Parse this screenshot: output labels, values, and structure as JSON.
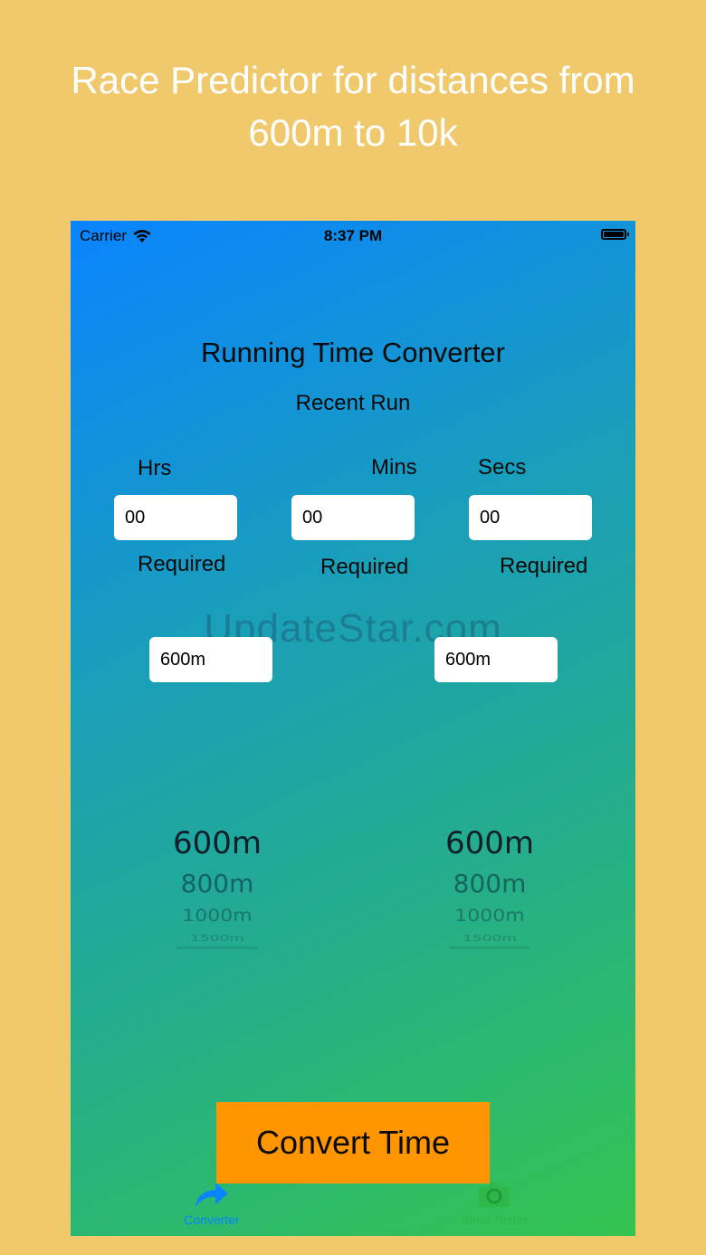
{
  "promo": {
    "line1": "Race Predictor for distances from",
    "line2": "600m to 10k"
  },
  "status_bar": {
    "carrier": "Carrier",
    "time": "8:37 PM"
  },
  "app": {
    "title": "Running Time Converter",
    "subtitle": "Recent Run",
    "labels": {
      "hrs": "Hrs",
      "mins": "Mins",
      "secs": "Secs"
    },
    "inputs": {
      "hrs": "00",
      "mins": "00",
      "secs": "00"
    },
    "required": {
      "hrs": "Required",
      "mins": "Required",
      "secs": "Required"
    },
    "from_distance": "600m",
    "to_distance": "600m",
    "watermark": "UpdateStar.com",
    "picker_left": [
      "600m",
      "800m",
      "1000m",
      "1500m"
    ],
    "picker_right": [
      "600m",
      "800m",
      "1000m",
      "1500m"
    ],
    "convert_button": "Convert Time"
  },
  "tab_bar": {
    "converter": {
      "label": "Converter",
      "icon": "share-arrow-icon",
      "color": "#0a84ff"
    },
    "shoe_tester": {
      "label": "Shoe Tester",
      "icon": "camera-icon",
      "color": "#2eb84a"
    }
  },
  "colors": {
    "background": "#f0c96c",
    "gradient_start": "#0a84ff",
    "gradient_end": "#34c44f",
    "button": "#ff9500"
  }
}
